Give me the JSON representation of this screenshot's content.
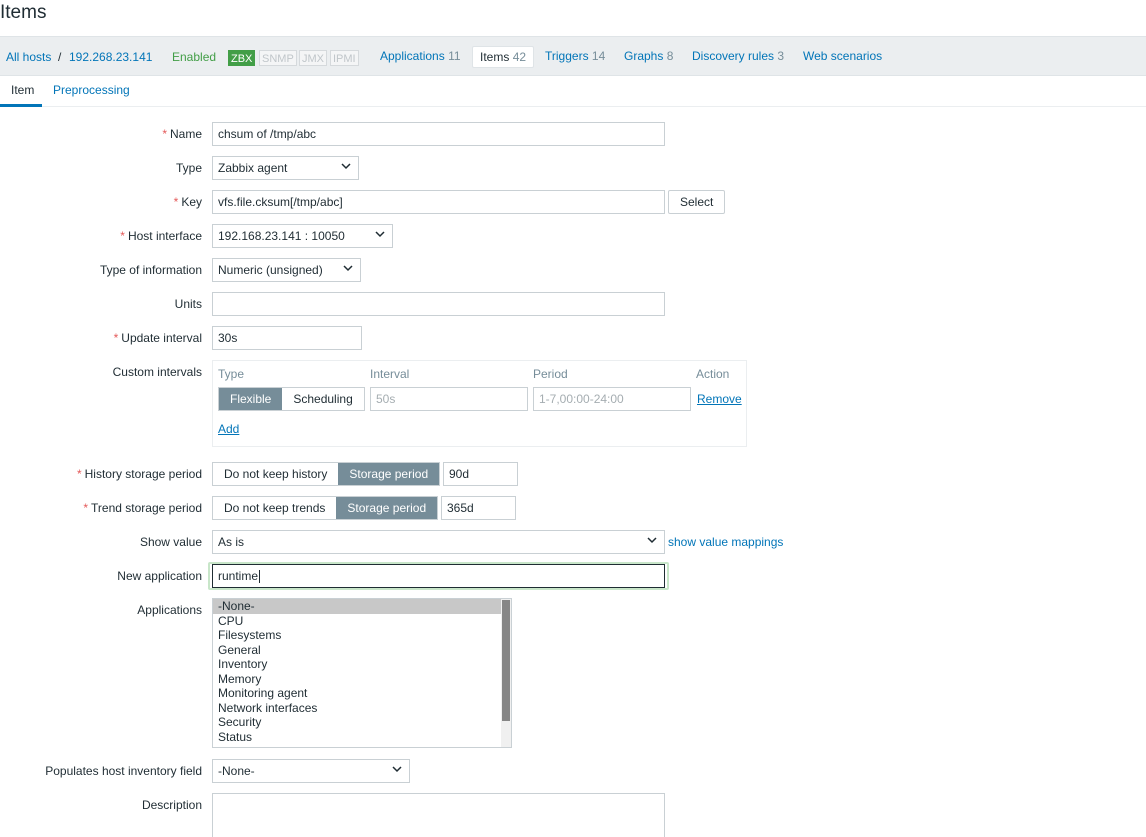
{
  "page_title": "Items",
  "hostbar": {
    "all_hosts": "All hosts",
    "separator": "/",
    "host": "192.268.23.141",
    "status": "Enabled",
    "availability": [
      "ZBX",
      "SNMP",
      "JMX",
      "IPMI"
    ],
    "tabs": [
      {
        "label": "Applications",
        "count": "11"
      },
      {
        "label": "Items",
        "count": "42"
      },
      {
        "label": "Triggers",
        "count": "14"
      },
      {
        "label": "Graphs",
        "count": "8"
      },
      {
        "label": "Discovery rules",
        "count": "3"
      },
      {
        "label": "Web scenarios",
        "count": ""
      }
    ]
  },
  "form_tabs": [
    "Item",
    "Preprocessing"
  ],
  "form": {
    "name": {
      "label": "Name",
      "value": "chsum of /tmp/abc"
    },
    "type": {
      "label": "Type",
      "value": "Zabbix agent"
    },
    "key": {
      "label": "Key",
      "value": "vfs.file.cksum[/tmp/abc]",
      "button": "Select"
    },
    "host_interface": {
      "label": "Host interface",
      "value": "192.168.23.141 : 10050"
    },
    "type_of_information": {
      "label": "Type of information",
      "value": "Numeric (unsigned)"
    },
    "units": {
      "label": "Units",
      "value": ""
    },
    "update_interval": {
      "label": "Update interval",
      "value": "30s"
    },
    "custom_intervals": {
      "label": "Custom intervals",
      "headers": {
        "type": "Type",
        "interval": "Interval",
        "period": "Period",
        "action": "Action"
      },
      "type_options": [
        "Flexible",
        "Scheduling"
      ],
      "interval_placeholder": "50s",
      "period_placeholder": "1-7,00:00-24:00",
      "remove": "Remove",
      "add": "Add"
    },
    "history": {
      "label": "History storage period",
      "options": [
        "Do not keep history",
        "Storage period"
      ],
      "value": "90d"
    },
    "trends": {
      "label": "Trend storage period",
      "options": [
        "Do not keep trends",
        "Storage period"
      ],
      "value": "365d"
    },
    "show_value": {
      "label": "Show value",
      "value": "As is",
      "link": "show value mappings"
    },
    "new_application": {
      "label": "New application",
      "value": "runtime"
    },
    "applications": {
      "label": "Applications",
      "options": [
        "-None-",
        "CPU",
        "Filesystems",
        "General",
        "Inventory",
        "Memory",
        "Monitoring agent",
        "Network interfaces",
        "Security",
        "Status"
      ]
    },
    "inventory_field": {
      "label": "Populates host inventory field",
      "value": "-None-"
    },
    "description": {
      "label": "Description",
      "value": ""
    }
  }
}
